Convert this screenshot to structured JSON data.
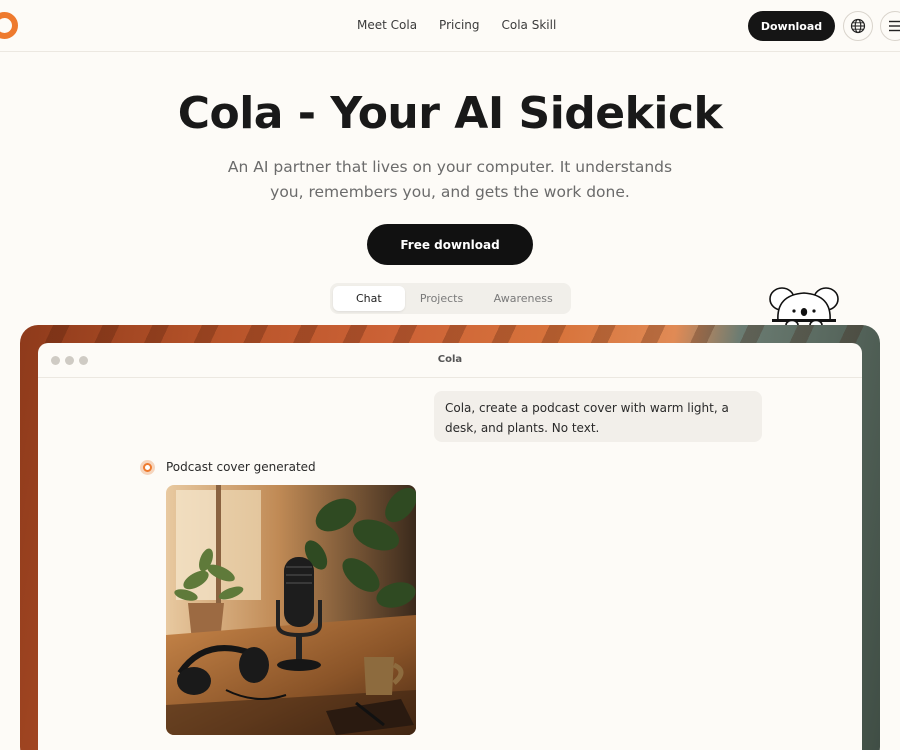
{
  "nav": {
    "logo_icon": "cola-ring-logo",
    "links": [
      "Meet Cola",
      "Pricing",
      "Cola Skill"
    ],
    "download_label": "Download",
    "globe_icon": "globe-icon",
    "menu_icon": "menu-icon"
  },
  "hero": {
    "title": "Cola - Your AI Sidekick",
    "subtitle": "An AI partner that lives on your computer. It understands you, remembers you, and gets the work done.",
    "cta_label": "Free download"
  },
  "tabs": {
    "items": [
      "Chat",
      "Projects",
      "Awareness"
    ],
    "active": "Chat"
  },
  "window": {
    "title": "Cola",
    "user_message": "Cola, create a podcast cover with warm light, a desk, and plants. No text.",
    "reply_label": "Podcast cover generated",
    "image_alt": "podcast cover image"
  },
  "colors": {
    "accent": "#ee7a2e",
    "dark": "#151515",
    "background": "#fdfbf7"
  }
}
